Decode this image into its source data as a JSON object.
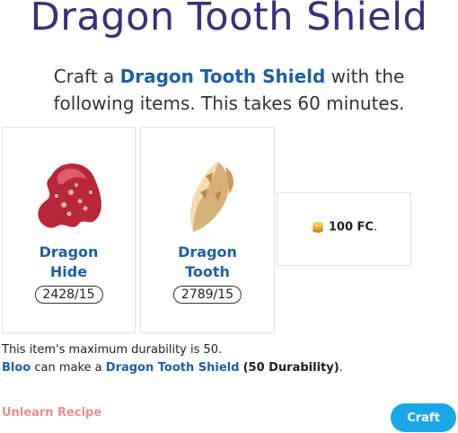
{
  "page": {
    "title": "Dragon Tooth Shield"
  },
  "intro": {
    "prefix": "Craft a ",
    "item_link": "Dragon Tooth Shield",
    "suffix": " with the following items. This takes 60 minutes."
  },
  "ingredients": [
    {
      "name_line1": "Dragon",
      "name_line2": "Hide",
      "quantity": "2428/15",
      "icon": "dragon-hide-icon"
    },
    {
      "name_line1": "Dragon",
      "name_line2": "Tooth",
      "quantity": "2789/15",
      "icon": "dragon-tooth-icon"
    }
  ],
  "cost": {
    "value": "100 FC",
    "trailing": ".",
    "icon": "gold-coin-icon"
  },
  "durability": {
    "line1": "This item's maximum durability is 50.",
    "crafter": "Bloo",
    "middle": " can make a ",
    "item_link": "Dragon Tooth Shield",
    "space": " ",
    "durability_text": "(50 Durability)",
    "end": "."
  },
  "actions": {
    "unlearn_label": "Unlearn Recipe",
    "craft_label": "Craft"
  },
  "colors": {
    "title": "#3b2f7a",
    "link": "#1e5fa8",
    "unlearn": "#e58f8f",
    "craft_button": "#1aa7e8"
  }
}
